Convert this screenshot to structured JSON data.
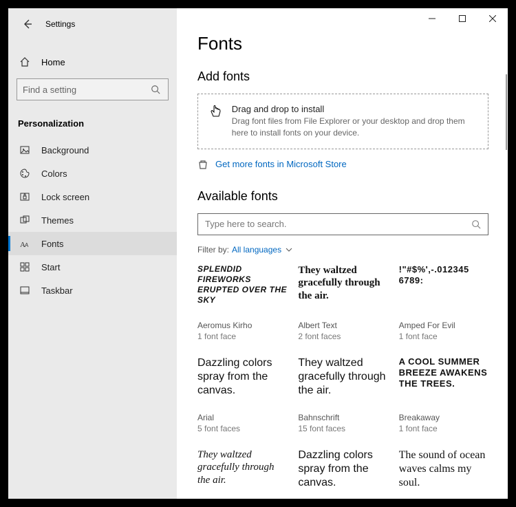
{
  "app_title": "Settings",
  "home_label": "Home",
  "search_placeholder": "Find a setting",
  "category": "Personalization",
  "nav": [
    {
      "icon": "image",
      "label": "Background"
    },
    {
      "icon": "palette",
      "label": "Colors"
    },
    {
      "icon": "lock",
      "label": "Lock screen"
    },
    {
      "icon": "themes",
      "label": "Themes"
    },
    {
      "icon": "fonts",
      "label": "Fonts",
      "active": true
    },
    {
      "icon": "start",
      "label": "Start"
    },
    {
      "icon": "taskbar",
      "label": "Taskbar"
    }
  ],
  "page_title": "Fonts",
  "add_fonts_title": "Add fonts",
  "drop_hdr": "Drag and drop to install",
  "drop_sub": "Drag font files from File Explorer or your desktop and drop them here to install fonts on your device.",
  "store_link": "Get more fonts in Microsoft Store",
  "available_title": "Available fonts",
  "font_search_placeholder": "Type here to search.",
  "filter_label": "Filter by:",
  "filter_value": "All languages",
  "fonts": [
    {
      "preview": "SPLENDID FIREWORKS ERUPTED OVER THE SKY",
      "name": "Aeromus Kirho",
      "faces": "1 font face",
      "style": "italic-outline"
    },
    {
      "preview": "They waltzed gracefully through the air.",
      "name": "Albert Text",
      "faces": "2 font faces",
      "style": "blackletter"
    },
    {
      "preview": "!\"#$%',-.012345 6789:",
      "name": "Amped For Evil",
      "faces": "1 font face",
      "style": "grunge"
    },
    {
      "preview": "Dazzling colors spray from the canvas.",
      "name": "Arial",
      "faces": "5 font faces",
      "style": "arial"
    },
    {
      "preview": "They waltzed gracefully through the air.",
      "name": "Bahnschrift",
      "faces": "15 font faces",
      "style": "bahn"
    },
    {
      "preview": "A COOL SUMMER BREEZE AWAKENS THE TREES.",
      "name": "Breakaway",
      "faces": "1 font face",
      "style": "grunge"
    },
    {
      "preview": "They waltzed gracefully through the air.",
      "name": "",
      "faces": "",
      "style": "script"
    },
    {
      "preview": "Dazzling colors spray from the canvas.",
      "name": "",
      "faces": "",
      "style": "arial"
    },
    {
      "preview": "The sound of ocean waves calms my soul.",
      "name": "",
      "faces": "",
      "style": "serif"
    }
  ]
}
